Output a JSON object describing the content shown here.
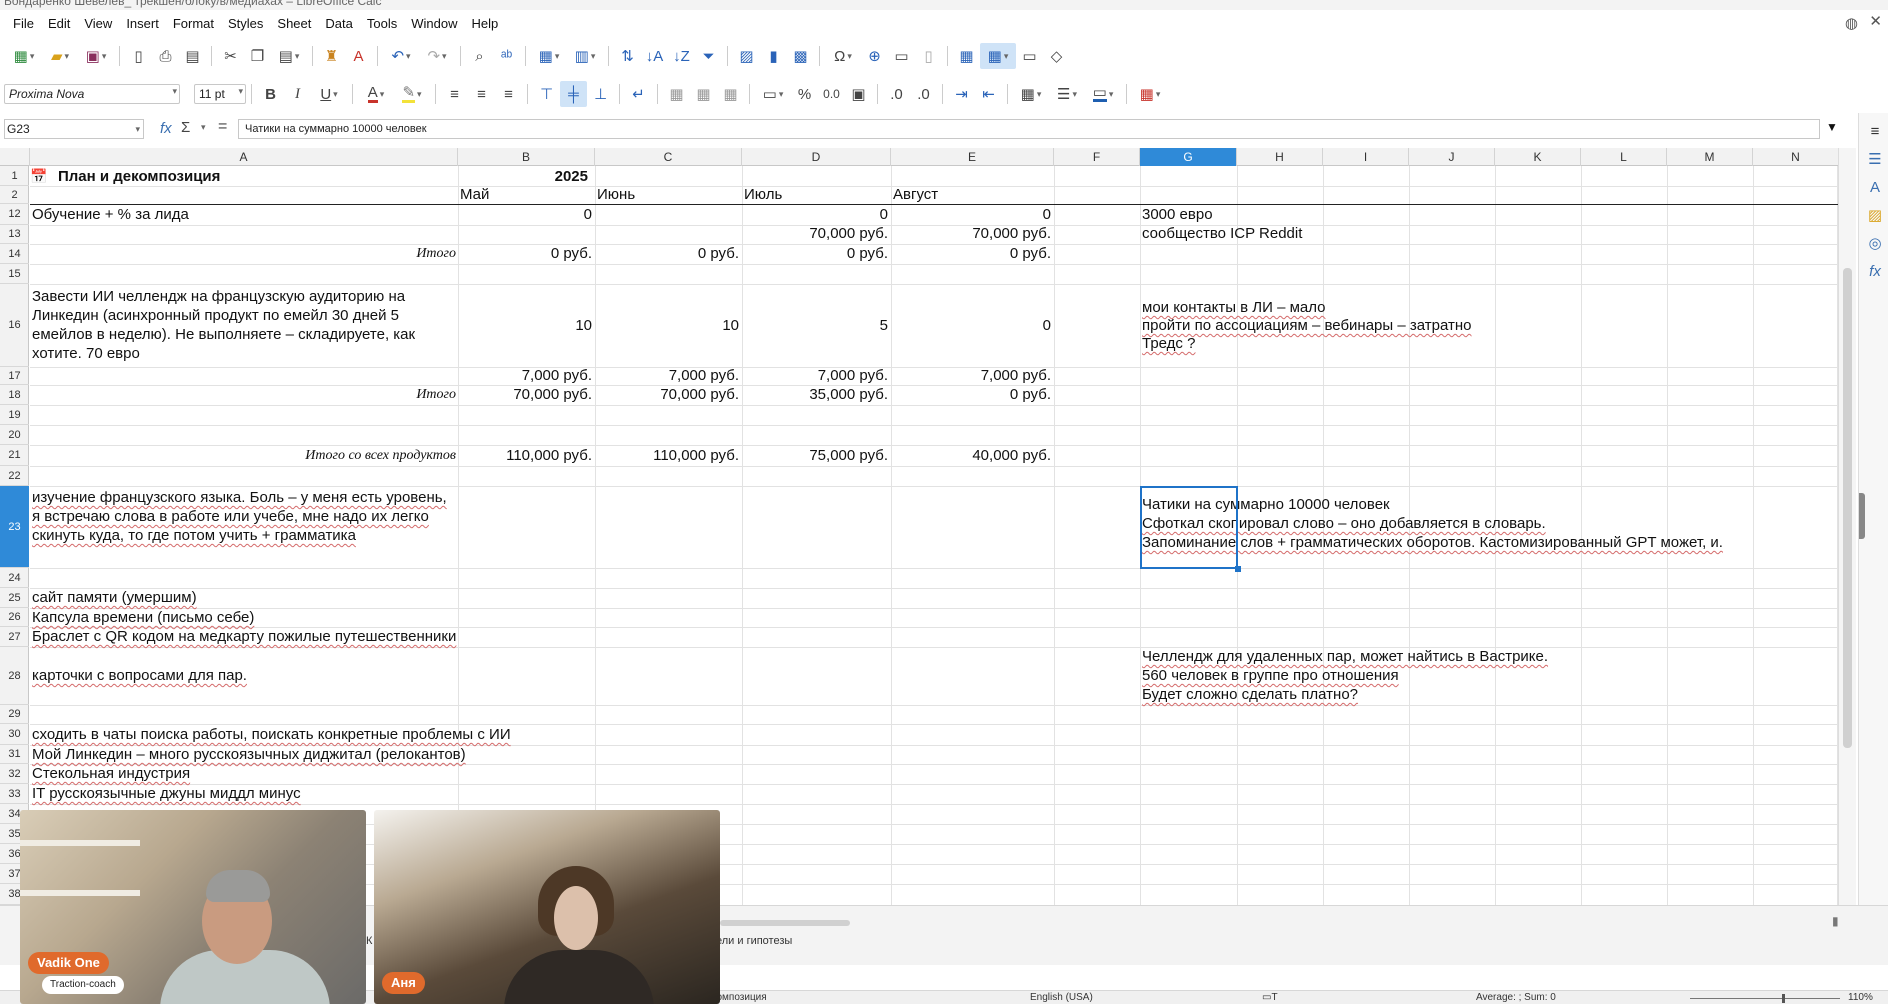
{
  "window": {
    "title": "Бондаренко Шевелёв_ трекшен/блоку/в/медиахах – LibreOffice Calc"
  },
  "menu": [
    "File",
    "Edit",
    "View",
    "Insert",
    "Format",
    "Styles",
    "Sheet",
    "Data",
    "Tools",
    "Window",
    "Help"
  ],
  "toolbar": {
    "font_name": "Proxima Nova",
    "font_size": "11 pt",
    "bold": "B",
    "italic": "I",
    "underline": "U",
    "percent": "%",
    "decimal": "0.0"
  },
  "formula_bar": {
    "name_box": "G23",
    "formula": "Чатики на суммарно 10000 человек"
  },
  "columns": [
    "A",
    "B",
    "C",
    "D",
    "E",
    "F",
    "G",
    "H",
    "I",
    "J",
    "K",
    "L",
    "M",
    "N"
  ],
  "rows": [
    "1",
    "2",
    "12",
    "13",
    "14",
    "15",
    "16",
    "17",
    "18",
    "19",
    "20",
    "21",
    "22",
    "23",
    "24",
    "25",
    "26",
    "27",
    "28",
    "29",
    "30",
    "31",
    "32",
    "33",
    "34",
    "35",
    "36",
    "37",
    "38"
  ],
  "cells": {
    "a1": "План и декомпозиция",
    "b1": "2025",
    "b2": "Май",
    "c2": "Июнь",
    "d2": "Июль",
    "e2": "Август",
    "a12": "Обучение + % за лида",
    "b12": "0",
    "d12": "0",
    "e12": "0",
    "g12": "3000 евро",
    "d13": "70,000 руб.",
    "e13": "70,000 руб.",
    "g13": "сообщество ICP Reddit",
    "a14": "Итого",
    "b14": "0 руб.",
    "c14": "0 руб.",
    "d14": "0 руб.",
    "e14": "0 руб.",
    "a16": "Завести ИИ челлендж на французскую аудиторию на Линкедин (асинхронный продукт по емейл 30 дней 5 емейлов в неделю). Не выполняете – складируете, как хотите. 70 евро",
    "b16": "10",
    "c16": "10",
    "d16": "5",
    "e16": "0",
    "g16a": "мои контакты в ЛИ – мало",
    "g16b": "пройти по ассоциациям – вебинары – затратно",
    "g16c": "Тредс ?",
    "b17": "7,000 руб.",
    "c17": "7,000 руб.",
    "d17": "7,000 руб.",
    "e17": "7,000 руб.",
    "a18": "Итого",
    "b18": "70,000 руб.",
    "c18": "70,000 руб.",
    "d18": "35,000 руб.",
    "e18": "0 руб.",
    "a21": "Итого со всех продуктов",
    "b21": "110,000 руб.",
    "c21": "110,000 руб.",
    "d21": "75,000 руб.",
    "e21": "40,000 руб.",
    "a23": "изучение французского языка. Боль – у меня есть уровень, я встречаю слова в работе или учебе, мне надо их легко скинуть куда, то где потом учить + грамматика",
    "g23a": "Чатики на суммарно 10000 человек",
    "g23b": "Сфоткал скопировал слово – оно добавляется в словарь.",
    "g23c": "Запоминание слов + грамматических оборотов. Кастомизированный GPT может, и.",
    "a25": "сайт памяти (умершим)",
    "a26": "Капсула времени (письмо себе)",
    "a27": "Браслет с QR кодом на медкарту пожилые путешественники",
    "a28": "карточки с вопросами для пар.",
    "g28a": "Челлендж для удаленных пар, может найтись в Вастрике.",
    "g28b": "560 человек в группе про отношения",
    "g28c": "Будет сложно сделать платно?",
    "a30": "сходить в чаты поиска работы, поискать конкретные проблемы с ИИ",
    "a31": "Мой Линкедин – много русскоязычных диджитал (релокантов)",
    "a32": "Стекольная индустрия",
    "a33": "IT русскоязычные джуны миддл минус"
  },
  "sheet_tabs": {
    "partial_tab": "ели и гипотезы",
    "partial_tab2": "К"
  },
  "status": {
    "sheet_name": "композиция",
    "language": "English (USA)",
    "summary": "Average: ; Sum: 0",
    "zoom": "110%"
  },
  "participants": [
    {
      "name": "Vadik One",
      "role": "Traction-coach"
    },
    {
      "name": "Аня"
    }
  ],
  "colors": {
    "selection": "#2f8ad8",
    "accent_orange": "#e06a2c"
  }
}
